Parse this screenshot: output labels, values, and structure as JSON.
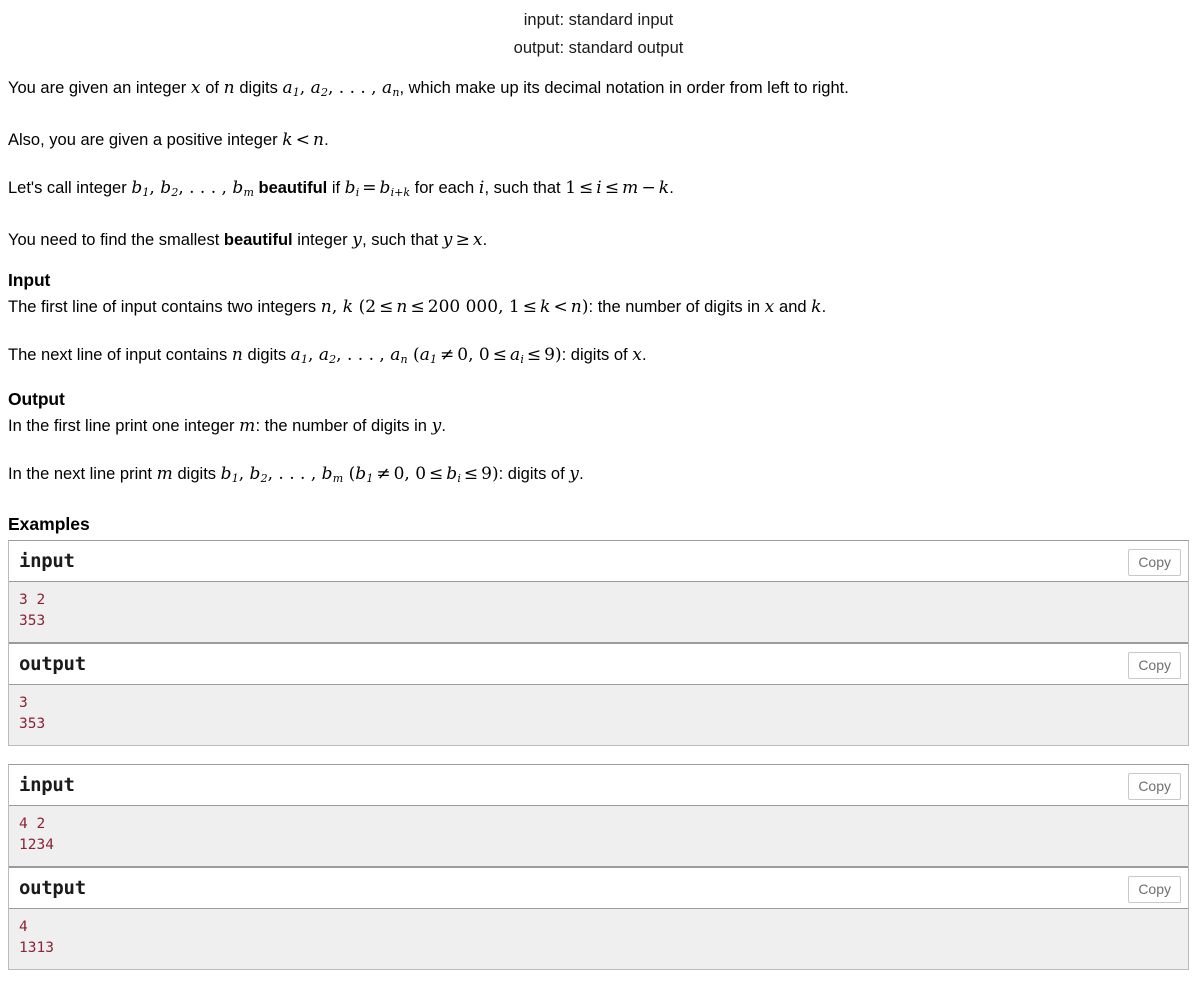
{
  "io": {
    "input_line": "input: standard input",
    "output_line": "output: standard output"
  },
  "statement": {
    "p1_a": "You are given an integer ",
    "p1_x": "x",
    "p1_b": " of ",
    "p1_n": "n",
    "p1_c": " digits ",
    "p1_a1": "a",
    "p1_a1s": "1",
    "p1_comma1": ", ",
    "p1_a2": "a",
    "p1_a2s": "2",
    "p1_dots": ", . . . , ",
    "p1_an": "a",
    "p1_ans": "n",
    "p1_d": ", which make up its decimal notation in order from left to right.",
    "p2_a": "Also, you are given a positive integer ",
    "p2_k": "k",
    "p2_lt": "<",
    "p2_n": "n",
    "p2_b": ".",
    "p3_a": "Let's call integer ",
    "p3_b1": "b",
    "p3_b1s": "1",
    "p3_c1": ", ",
    "p3_b2": "b",
    "p3_b2s": "2",
    "p3_dots": ", . . . , ",
    "p3_bm": "b",
    "p3_bms": "m",
    "p3_beautiful": "beautiful",
    "p3_if": " if ",
    "p3_bi": "b",
    "p3_bis": "i",
    "p3_eq": "=",
    "p3_bik": "b",
    "p3_biks": "i+k",
    "p3_foreach": " for each ",
    "p3_i": "i",
    "p3_suchthat": ", such that ",
    "p3_one": "1",
    "p3_le1": "≤",
    "p3_i2": "i",
    "p3_le2": "≤",
    "p3_m": "m",
    "p3_minus": "−",
    "p3_k": "k",
    "p3_end": ".",
    "p4_a": "You need to find the smallest ",
    "p4_beautiful": "beautiful",
    "p4_b": " integer ",
    "p4_y": "y",
    "p4_c": ", such that ",
    "p4_y2": "y",
    "p4_ge": "≥",
    "p4_x": "x",
    "p4_d": "."
  },
  "input_section": {
    "title": "Input",
    "l1_a": "The first line of input contains two integers ",
    "l1_n": "n",
    "l1_comma": ", ",
    "l1_k": "k",
    "l1_open": " (",
    "l1_2": "2",
    "l1_le1": "≤",
    "l1_n2": "n",
    "l1_le2": "≤",
    "l1_200000": "200 000",
    "l1_comma2": ", ",
    "l1_1": "1",
    "l1_le3": "≤",
    "l1_k2": "k",
    "l1_lt": "<",
    "l1_n3": "n",
    "l1_close": ")",
    "l1_b": ": the number of digits in ",
    "l1_x": "x",
    "l1_c": " and ",
    "l1_k3": "k",
    "l1_d": ".",
    "l2_a": "The next line of input contains ",
    "l2_n": "n",
    "l2_b": " digits ",
    "l2_a1": "a",
    "l2_a1s": "1",
    "l2_c1": ", ",
    "l2_a2": "a",
    "l2_a2s": "2",
    "l2_dots": ", . . . , ",
    "l2_an": "a",
    "l2_ans": "n",
    "l2_open": " (",
    "l2_a1b": "a",
    "l2_a1bs": "1",
    "l2_neq": "≠",
    "l2_zero": "0",
    "l2_comma2": ", ",
    "l2_zero2": "0",
    "l2_le1": "≤",
    "l2_ai": "a",
    "l2_ais": "i",
    "l2_le2": "≤",
    "l2_nine": "9",
    "l2_close": ")",
    "l2_c": ": digits of ",
    "l2_x": "x",
    "l2_d": "."
  },
  "output_section": {
    "title": "Output",
    "l1_a": "In the first line print one integer ",
    "l1_m": "m",
    "l1_b": ": the number of digits in ",
    "l1_y": "y",
    "l1_c": ".",
    "l2_a": "In the next line print ",
    "l2_m": "m",
    "l2_b": " digits ",
    "l2_b1": "b",
    "l2_b1s": "1",
    "l2_c1": ", ",
    "l2_b2": "b",
    "l2_b2s": "2",
    "l2_dots": ", . . . , ",
    "l2_bm": "b",
    "l2_bms": "m",
    "l2_open": " (",
    "l2_b1b": "b",
    "l2_b1bs": "1",
    "l2_neq": "≠",
    "l2_zero": "0",
    "l2_comma2": ", ",
    "l2_zero2": "0",
    "l2_le1": "≤",
    "l2_bi": "b",
    "l2_bis": "i",
    "l2_le2": "≤",
    "l2_nine": "9",
    "l2_close": ")",
    "l2_c": ": digits of ",
    "l2_y": "y",
    "l2_d": "."
  },
  "examples": {
    "title": "Examples",
    "copy_label": "Copy",
    "input_label": "input",
    "output_label": "output",
    "tests": [
      {
        "input_label": "input",
        "input_data": "3 2\n353",
        "output_label": "output",
        "output_data": "3\n353",
        "copy_label": "Copy"
      },
      {
        "input_label": "input",
        "input_data": "4 2\n1234",
        "output_label": "output",
        "output_data": "4\n1313",
        "copy_label": "Copy"
      }
    ]
  },
  "colors": {
    "sample_data_text": "#8b2335",
    "sample_data_bg": "#efefef",
    "border": "#9b9b9b",
    "copy_text": "#6f6f6f"
  }
}
